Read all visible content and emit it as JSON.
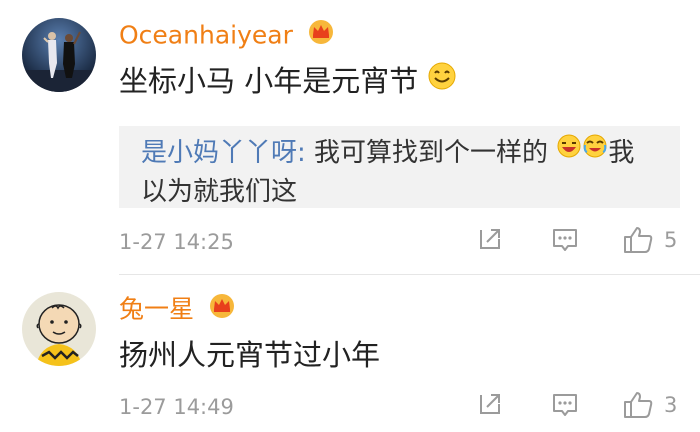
{
  "comments": [
    {
      "username": "Oceanhaiyear",
      "text": "坐标小马 小年是元宵节",
      "quote": {
        "user": "是小妈丫丫呀",
        "text_line1": "我可算找到个一样的",
        "text_line1_end": "我",
        "text_line2": "以为就我们这"
      },
      "time": "1-27 14:25",
      "likes": "5"
    },
    {
      "username": "兔一星",
      "text": "扬州人元宵节过小年",
      "time": "1-27 14:49",
      "likes": "3"
    }
  ],
  "icons": {
    "vip": "crown-badge-icon",
    "repost": "repost-icon",
    "comment": "comment-icon",
    "like": "like-icon",
    "emoji_smile": "smile-emoji-icon",
    "emoji_laugh": "laugh-emoji-icon",
    "emoji_cry_laugh": "cry-laugh-emoji-icon"
  },
  "colors": {
    "username": "#f07f15",
    "quote_user": "#4f7ab6",
    "meta": "#9b9b9b",
    "quote_bg": "#f2f2f2"
  }
}
